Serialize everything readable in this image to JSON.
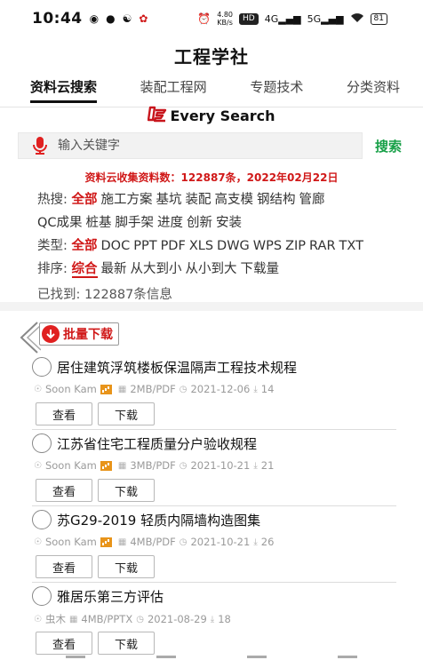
{
  "status_bar": {
    "time": "10:44",
    "speed_top": "4.80",
    "speed_bottom": "KB/s",
    "hd": "HD",
    "net1": "4G",
    "net2": "5G",
    "battery": "81"
  },
  "app_title": "工程学社",
  "tabs": [
    {
      "label": "资料云搜索",
      "active": true
    },
    {
      "label": "装配工程网",
      "active": false
    },
    {
      "label": "专题技术",
      "active": false
    },
    {
      "label": "分类资料",
      "active": false
    }
  ],
  "brand": {
    "text": "Every Search",
    "logo_color": "#c8161d"
  },
  "search": {
    "placeholder": "输入关键字",
    "button": "搜索"
  },
  "stats_text": "资料云收集资料数：122887条，2022年02月22日",
  "hot": {
    "label": "热搜:",
    "items": [
      "全部",
      "施工方案",
      "基坑",
      "装配",
      "高支模",
      "钢结构",
      "管廊",
      "QC成果",
      "桩基",
      "脚手架",
      "进度",
      "创新",
      "安装"
    ]
  },
  "types": {
    "label": "类型:",
    "items": [
      "全部",
      "DOC",
      "PPT",
      "PDF",
      "XLS",
      "DWG",
      "WPS",
      "ZIP",
      "RAR",
      "TXT"
    ]
  },
  "sort": {
    "label": "排序:",
    "items": [
      "综合",
      "最新",
      "从大到小",
      "从小到大",
      "下载量"
    ]
  },
  "found_text": "已找到: 122887条信息",
  "batch_download": "批量下载",
  "items": [
    {
      "title": "居住建筑浮筑楼板保温隔声工程技术规程",
      "author": "Soon Kam",
      "vip": true,
      "size": "2MB/PDF",
      "date": "2021-12-06",
      "downloads": "14",
      "view": "查看",
      "download": "下载"
    },
    {
      "title": "江苏省住宅工程质量分户验收规程",
      "author": "Soon Kam",
      "vip": true,
      "size": "3MB/PDF",
      "date": "2021-10-21",
      "downloads": "21",
      "view": "查看",
      "download": "下载"
    },
    {
      "title": "苏G29-2019 轻质内隔墙构造图集",
      "author": "Soon Kam",
      "vip": true,
      "size": "4MB/PDF",
      "date": "2021-10-21",
      "downloads": "26",
      "view": "查看",
      "download": "下载"
    },
    {
      "title": "雅居乐第三方评估",
      "author": "虫木",
      "vip": false,
      "size": "4MB/PPTX",
      "date": "2021-08-29",
      "downloads": "18",
      "view": "查看",
      "download": "下载"
    }
  ],
  "colors": {
    "accent_red": "#d01818",
    "search_green": "#18a048",
    "vip_orange": "#e8941a"
  }
}
